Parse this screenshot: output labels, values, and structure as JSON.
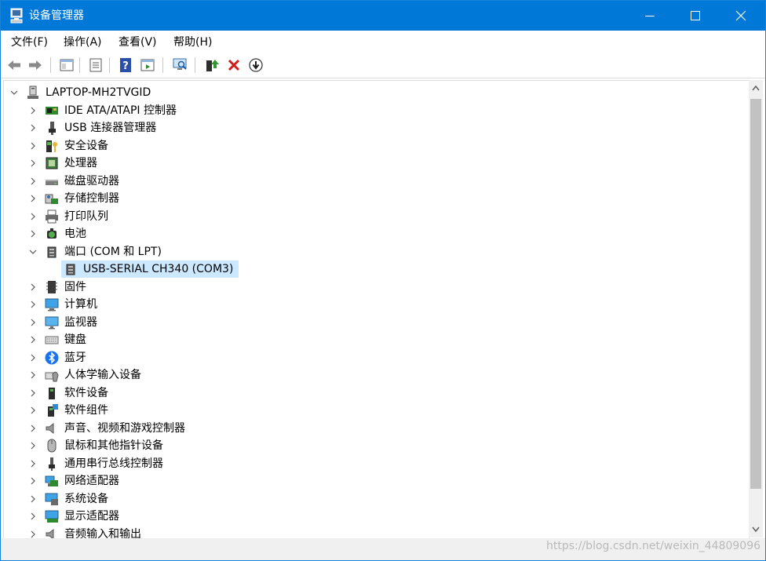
{
  "window": {
    "title": "设备管理器",
    "accent": "#0078d7"
  },
  "menu": [
    "文件(F)",
    "操作(A)",
    "查看(V)",
    "帮助(H)"
  ],
  "toolbar": {
    "icons": [
      "back-arrow-icon",
      "forward-arrow-icon",
      "show-hide-console-tree-icon",
      "properties-icon",
      "help-icon",
      "action-pane-icon",
      "scan-hardware-icon",
      "update-driver-icon",
      "uninstall-device-icon",
      "disable-device-icon"
    ]
  },
  "tree": {
    "root": "LAPTOP-MH2TVGID",
    "categories": [
      {
        "label": "IDE ATA/ATAPI 控制器",
        "icon": "ide-controller-icon",
        "expanded": false
      },
      {
        "label": "USB 连接器管理器",
        "icon": "usb-connector-icon",
        "expanded": false
      },
      {
        "label": "安全设备",
        "icon": "security-device-icon",
        "expanded": false
      },
      {
        "label": "处理器",
        "icon": "processor-icon",
        "expanded": false
      },
      {
        "label": "磁盘驱动器",
        "icon": "disk-drive-icon",
        "expanded": false
      },
      {
        "label": "存储控制器",
        "icon": "storage-controller-icon",
        "expanded": false
      },
      {
        "label": "打印队列",
        "icon": "printer-icon",
        "expanded": false
      },
      {
        "label": "电池",
        "icon": "battery-icon",
        "expanded": false
      },
      {
        "label": "端口 (COM 和 LPT)",
        "icon": "port-icon",
        "expanded": true,
        "children": [
          {
            "label": "USB-SERIAL CH340 (COM3)",
            "icon": "serial-port-icon",
            "selected": true
          }
        ]
      },
      {
        "label": "固件",
        "icon": "firmware-icon",
        "expanded": false
      },
      {
        "label": "计算机",
        "icon": "computer-icon",
        "expanded": false
      },
      {
        "label": "监视器",
        "icon": "monitor-icon",
        "expanded": false
      },
      {
        "label": "键盘",
        "icon": "keyboard-icon",
        "expanded": false
      },
      {
        "label": "蓝牙",
        "icon": "bluetooth-icon",
        "expanded": false
      },
      {
        "label": "人体学输入设备",
        "icon": "hid-icon",
        "expanded": false
      },
      {
        "label": "软件设备",
        "icon": "software-device-icon",
        "expanded": false
      },
      {
        "label": "软件组件",
        "icon": "software-component-icon",
        "expanded": false
      },
      {
        "label": "声音、视频和游戏控制器",
        "icon": "sound-icon",
        "expanded": false
      },
      {
        "label": "鼠标和其他指针设备",
        "icon": "mouse-icon",
        "expanded": false
      },
      {
        "label": "通用串行总线控制器",
        "icon": "usb-controller-icon",
        "expanded": false
      },
      {
        "label": "网络适配器",
        "icon": "network-adapter-icon",
        "expanded": false
      },
      {
        "label": "系统设备",
        "icon": "system-device-icon",
        "expanded": false
      },
      {
        "label": "显示适配器",
        "icon": "display-adapter-icon",
        "expanded": false
      },
      {
        "label": "音频输入和输出",
        "icon": "audio-io-icon",
        "expanded": false
      }
    ]
  },
  "watermark": "https://blog.csdn.net/weixin_44809096"
}
